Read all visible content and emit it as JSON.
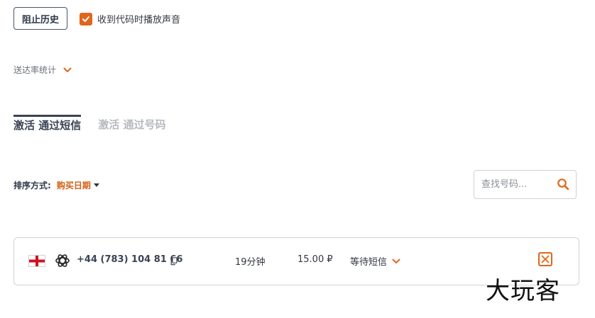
{
  "toolbar": {
    "block_history_label": "阻止历史",
    "sound_option_label": "收到代码时播放声音",
    "sound_option_checked": true
  },
  "stats": {
    "label": "送达率统计"
  },
  "tabs": [
    {
      "label": "激活 通过短信",
      "active": true
    },
    {
      "label": "激活 通过号码",
      "active": false
    }
  ],
  "sort": {
    "label": "排序方式:",
    "value": "购买日期"
  },
  "search": {
    "placeholder": "查找号码..."
  },
  "activations": [
    {
      "country_flag": "england-flag-icon",
      "service_icon": "openai-icon",
      "phone": "+44 (783) 104 81 66",
      "duration": "19分钟",
      "price": "15.00 ₽",
      "status": "等待短信"
    }
  ],
  "watermark": "大玩客",
  "colors": {
    "accent": "#e0661c",
    "sort_value": "#d35e14",
    "active_tab": "#3a4354",
    "inactive_tab": "#b6b9be",
    "border": "#cfd2d6"
  }
}
